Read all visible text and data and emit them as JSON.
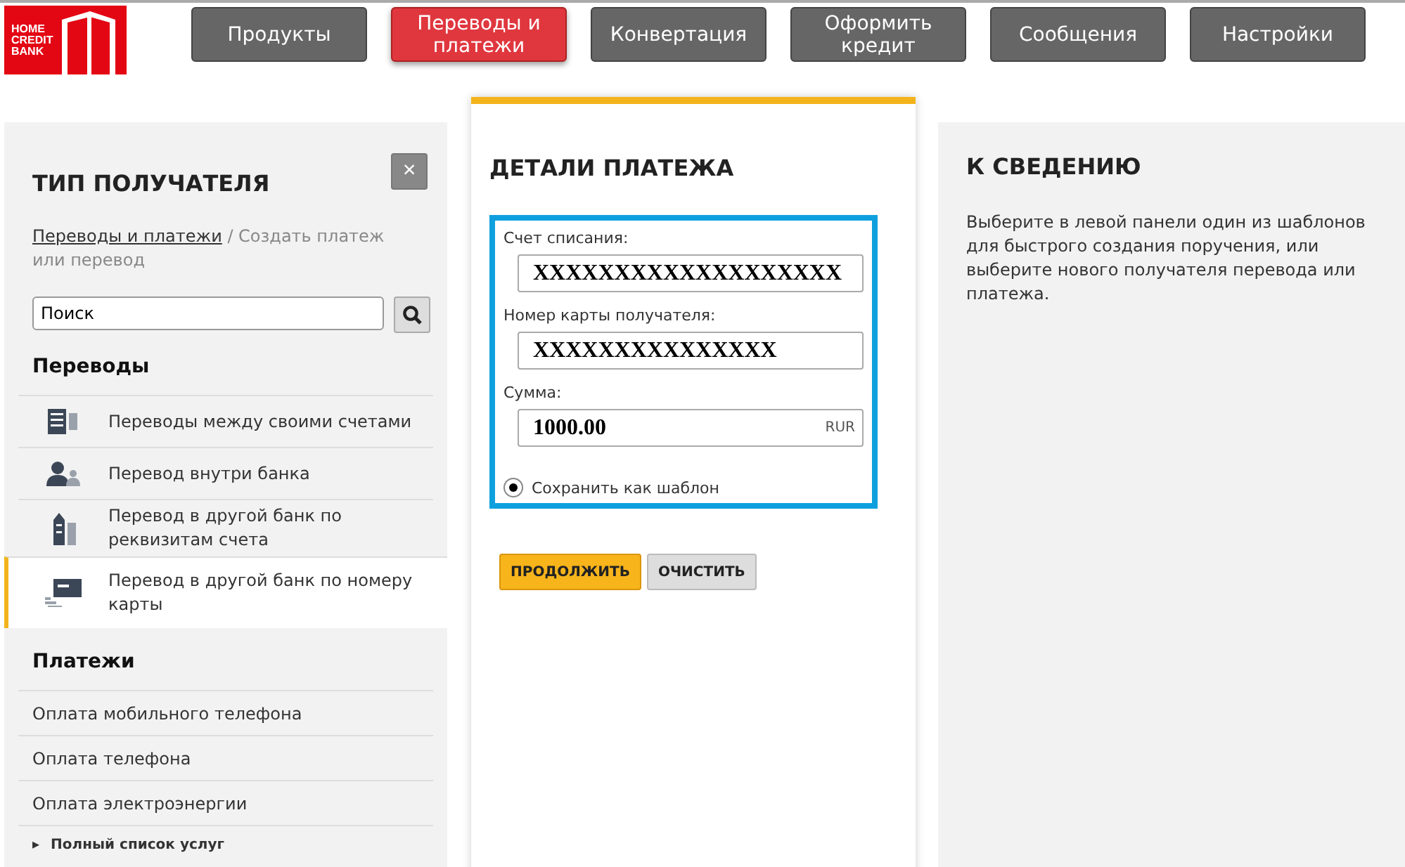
{
  "logo": {
    "lines": [
      "HOME",
      "CREDIT",
      "BANK"
    ]
  },
  "nav": [
    {
      "label": "Продукты",
      "selected": false
    },
    {
      "label": "Переводы и платежи",
      "selected": true
    },
    {
      "label": "Конвертация",
      "selected": false
    },
    {
      "label": "Оформить кредит",
      "selected": false
    },
    {
      "label": "Сообщения",
      "selected": false
    },
    {
      "label": "Настройки",
      "selected": false
    }
  ],
  "left_panel": {
    "title": "ТИП ПОЛУЧАТЕЛЯ",
    "close": "×",
    "breadcrumb": {
      "link": "Переводы и платежи",
      "rest": " / Создать платеж или перевод"
    },
    "search": {
      "value": "Поиск"
    },
    "transfers_heading": "Переводы",
    "transfers": [
      {
        "label": "Переводы между своими счетами",
        "kind": "accounts",
        "selected": false
      },
      {
        "label": "Перевод внутри банка",
        "kind": "person",
        "selected": false
      },
      {
        "label": "Перевод в другой банк по реквизитам счета",
        "kind": "building",
        "selected": false
      },
      {
        "label": "Перевод в другой банк по номеру карты",
        "kind": "card",
        "selected": true
      }
    ],
    "payments_heading": "Платежи",
    "payments": [
      "Оплата мобильного телефона",
      "Оплата телефона",
      "Оплата электроэнергии"
    ],
    "more": {
      "marker": "▸",
      "label": "Полный список услуг"
    }
  },
  "details": {
    "title": "ДЕТАЛИ ПЛАТЕЖА",
    "fields": [
      {
        "label": "Счет списания:",
        "value": "XXXXXXXXXXXXXXXXXXX"
      },
      {
        "label": "Номер карты получателя:",
        "value": "XXXXXXXXXXXXXXX"
      },
      {
        "label": "Сумма:",
        "value": "1000.00",
        "suffix": "RUR"
      }
    ],
    "save_template": {
      "label": "Сохранить как шаблон",
      "checked": true
    },
    "buttons": [
      {
        "label": "ПРОДОЛЖИТЬ",
        "kind": "primary"
      },
      {
        "label": "ОЧИСТИТЬ",
        "kind": "secondary"
      }
    ]
  },
  "info": {
    "title": "К СВЕДЕНИЮ",
    "text": "Выберите в левой панели один из шаблонов для быстрого создания поручения, или выберите нового получателя перевода или платежа."
  }
}
